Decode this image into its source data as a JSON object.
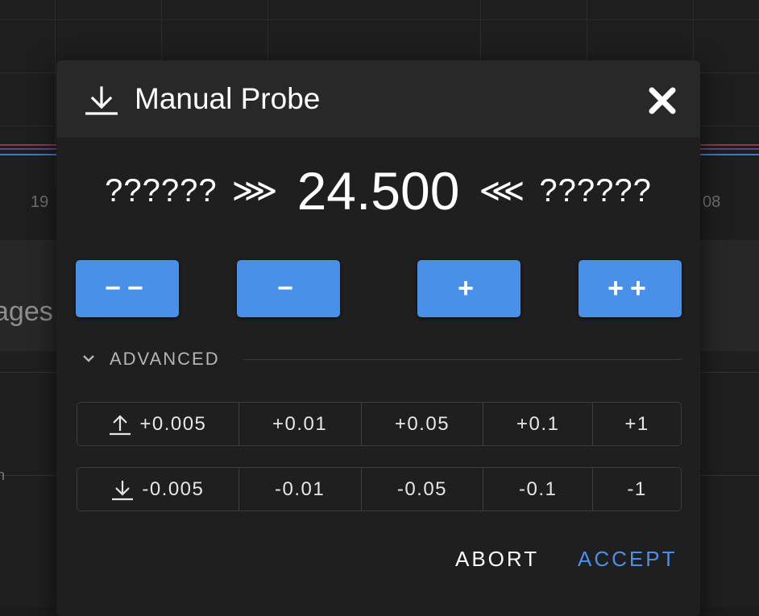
{
  "background": {
    "tick_left": "19",
    "tick_right": "08",
    "panel_text": "ages",
    "small_text": "n"
  },
  "dialog": {
    "title": "Manual Probe",
    "header_icon": "download-icon",
    "close_icon": "close-icon",
    "probe": {
      "left_text": "??????",
      "left_arrows": "⋙",
      "value": "24.500",
      "right_arrows": "⋘",
      "right_text": "??????"
    },
    "step_buttons": {
      "down_large": "−−",
      "down_small": "−",
      "up_small": "+",
      "up_large": "++"
    },
    "advanced": {
      "label": "ADVANCED",
      "icon": "chevron-down-icon"
    },
    "raise_offsets": [
      "+0.005",
      "+0.01",
      "+0.05",
      "+0.1",
      "+1"
    ],
    "lower_offsets": [
      "-0.005",
      "-0.01",
      "-0.05",
      "-0.1",
      "-1"
    ],
    "raise_icon": "upload-icon",
    "lower_icon": "download-icon",
    "abort_label": "ABORT",
    "accept_label": "ACCEPT"
  },
  "colors": {
    "accent": "#4b90e8",
    "accept_text": "#4b90e8",
    "dialog_bg": "#1f1f1f",
    "header_bg": "#282828"
  }
}
